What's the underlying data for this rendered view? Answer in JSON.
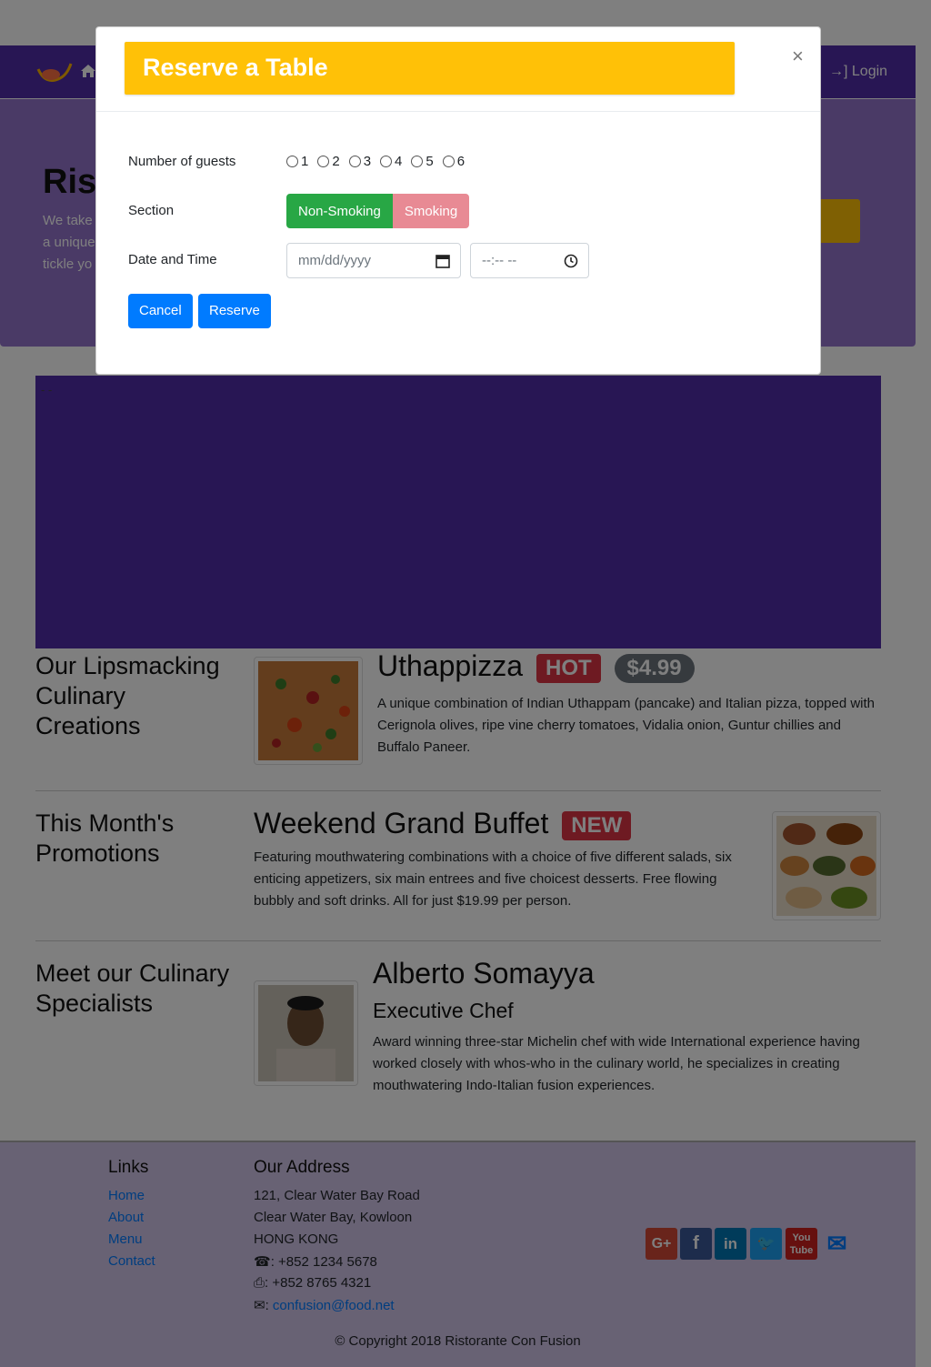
{
  "nav": {
    "login_label": "Login"
  },
  "jumbotron": {
    "title": "Rist",
    "text_lines": [
      "We take",
      "a unique",
      "tickle yo"
    ]
  },
  "carousel": {
    "placeholder": "- -"
  },
  "sections": {
    "dishes": {
      "heading": "Our Lipsmacking Culinary Creations",
      "name": "Uthappizza",
      "badge": "HOT",
      "price": "$4.99",
      "description": "A unique combination of Indian Uthappam (pancake) and Italian pizza, topped with Cerignola olives, ripe vine cherry tomatoes, Vidalia onion, Guntur chillies and Buffalo Paneer."
    },
    "promotion": {
      "heading": "This Month's Promotions",
      "name": "Weekend Grand Buffet",
      "badge": "NEW",
      "description": "Featuring mouthwatering combinations with a choice of five different salads, six enticing appetizers, six main entrees and five choicest desserts. Free flowing bubbly and soft drinks. All for just $19.99 per person."
    },
    "leader": {
      "heading": "Meet our Culinary Specialists",
      "name": "Alberto Somayya",
      "designation": "Executive Chef",
      "description": "Award winning three-star Michelin chef with wide International experience having worked closely with whos-who in the culinary world, he specializes in creating mouthwatering Indo-Italian fusion experiences."
    }
  },
  "footer": {
    "links_heading": "Links",
    "links": [
      "Home",
      "About",
      "Menu",
      "Contact"
    ],
    "address_heading": "Our Address",
    "address": [
      "121, Clear Water Bay Road",
      "Clear Water Bay, Kowloon",
      "HONG KONG"
    ],
    "phone": ": +852 1234 5678",
    "fax": ": +852 8765 4321",
    "email": "confusion@food.net",
    "social": [
      "google-plus",
      "facebook",
      "linkedin",
      "twitter",
      "youtube",
      "mail"
    ],
    "copyright": "© Copyright 2018 Ristorante Con Fusion"
  },
  "modal": {
    "title": "Reserve a Table",
    "close": "×",
    "guests_label": "Number of guests",
    "guest_options": [
      "1",
      "2",
      "3",
      "4",
      "5",
      "6"
    ],
    "section_label": "Section",
    "section_options": [
      "Non-Smoking",
      "Smoking"
    ],
    "datetime_label": "Date and Time",
    "date_placeholder": "mm/dd/yyyy",
    "time_placeholder": "--:-- --",
    "cancel_label": "Cancel",
    "reserve_label": "Reserve"
  },
  "colors": {
    "primary": "#512da8",
    "jumbotron": "#9575cd",
    "footer": "#d1c4e9",
    "modal_title_bg": "#ffc107",
    "success": "#28a745",
    "danger": "#dc3545",
    "link": "#007bff"
  }
}
